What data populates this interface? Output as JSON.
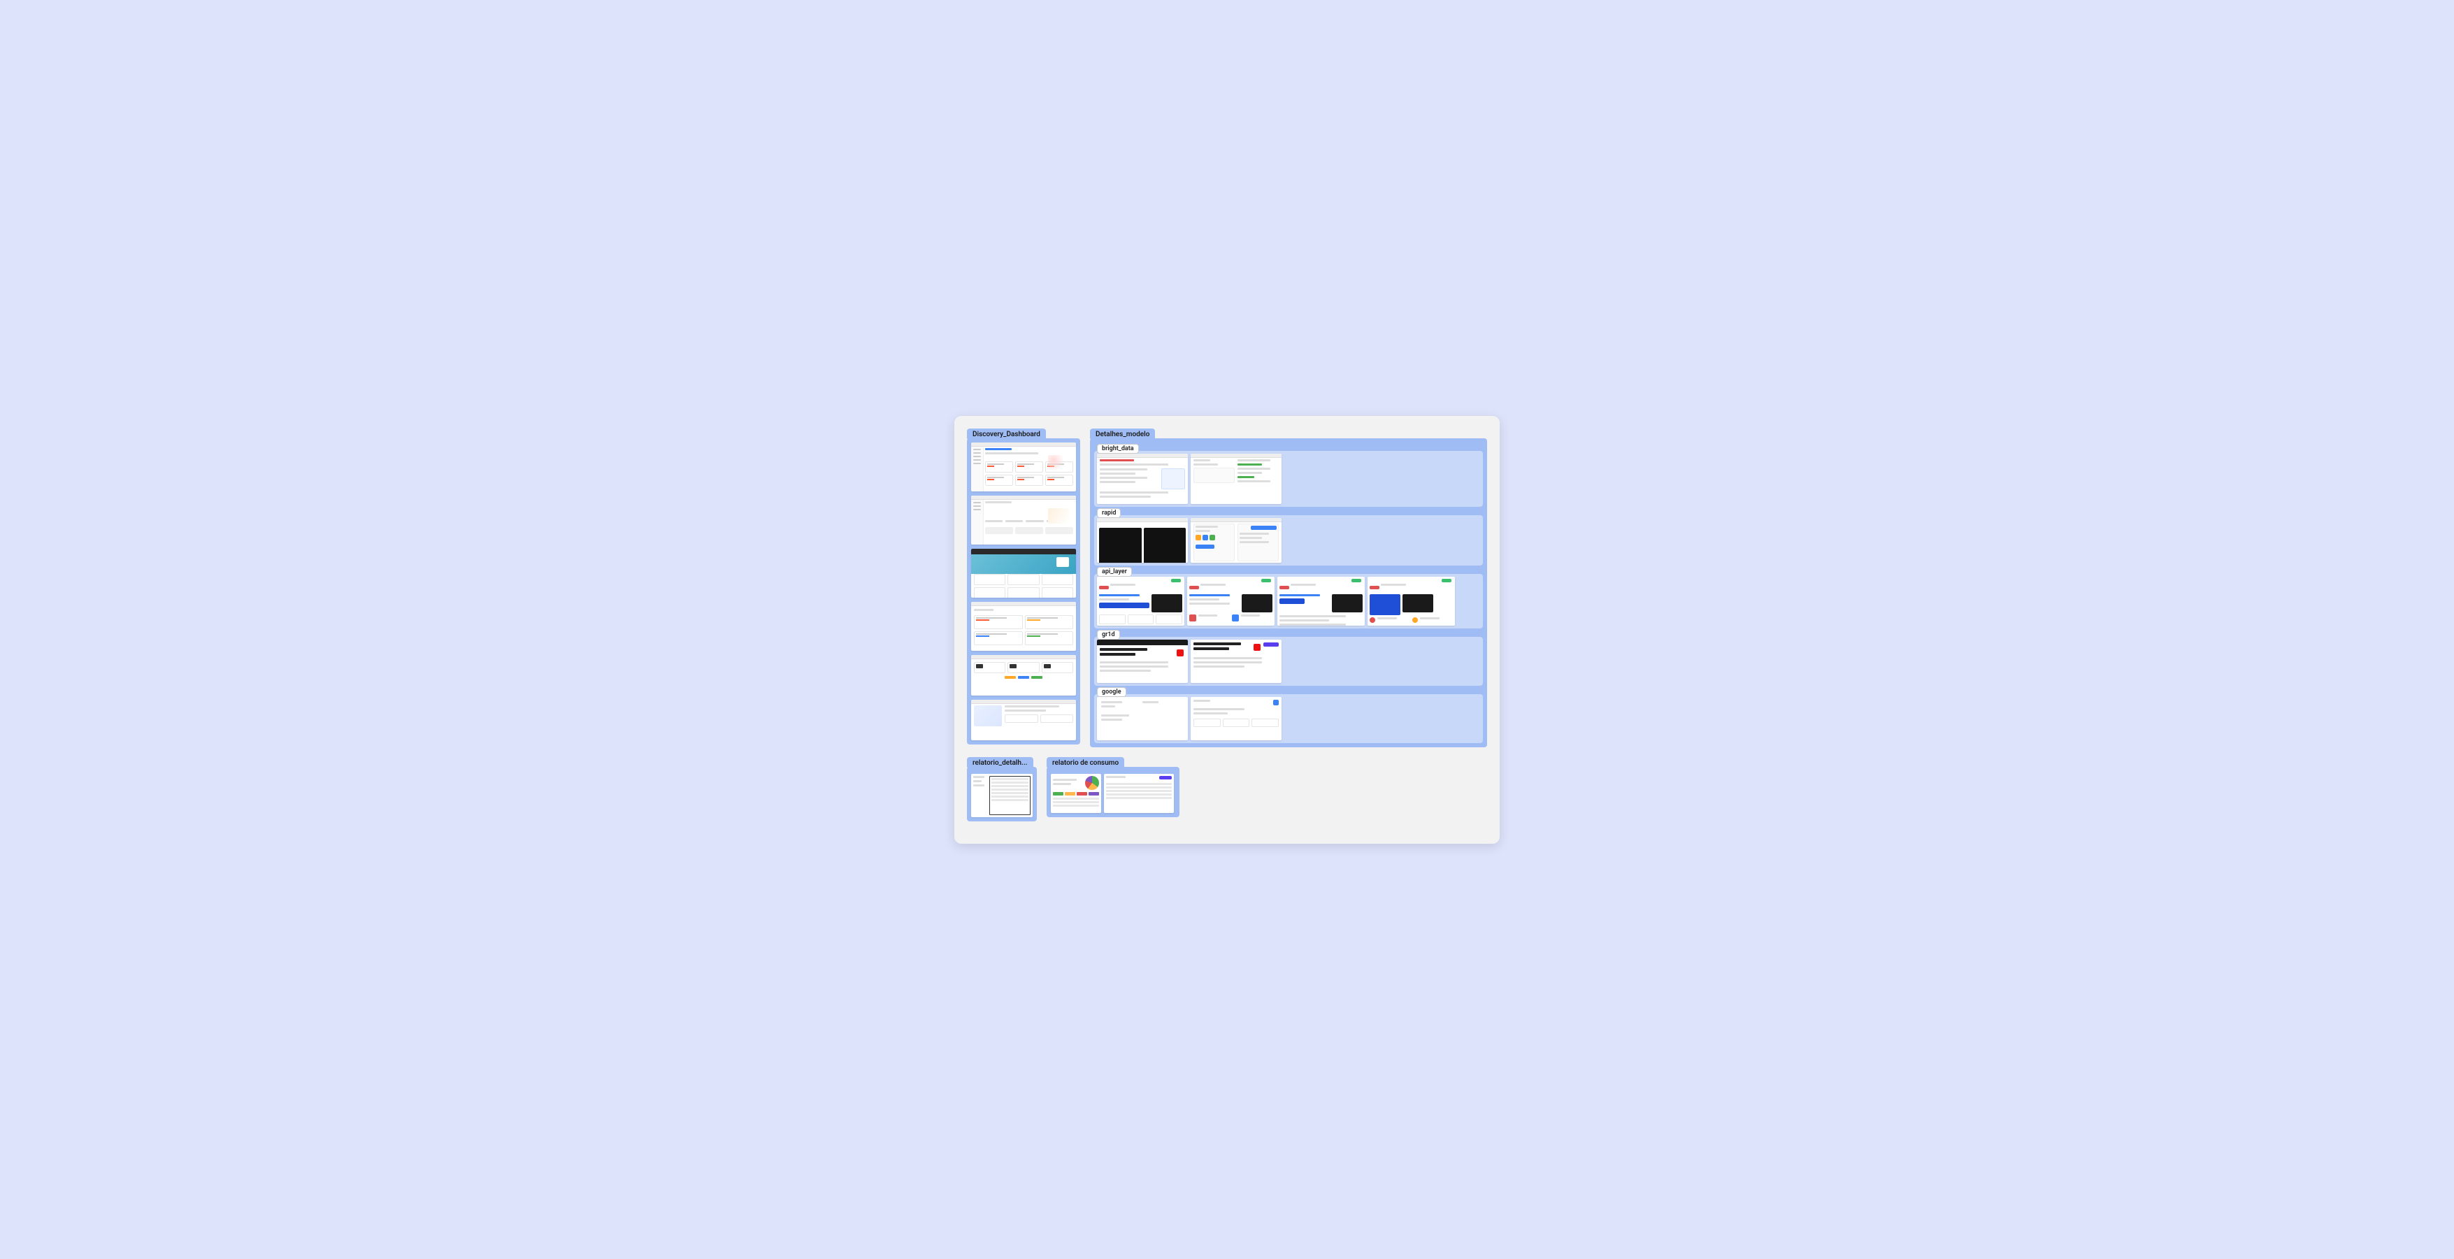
{
  "sections": {
    "discovery": {
      "label": "Discovery_Dashboard"
    },
    "detalhes": {
      "label": "Detalhes_modelo",
      "subs": {
        "bright": "bright_data",
        "rapid": "rapid",
        "apilayer": "api_layer",
        "gr1d": "gr1d",
        "google": "google"
      }
    },
    "relatorio_detalh": {
      "label": "relatorio_detalh..."
    },
    "relatorio_consumo": {
      "label": "relatorio de consumo"
    }
  }
}
